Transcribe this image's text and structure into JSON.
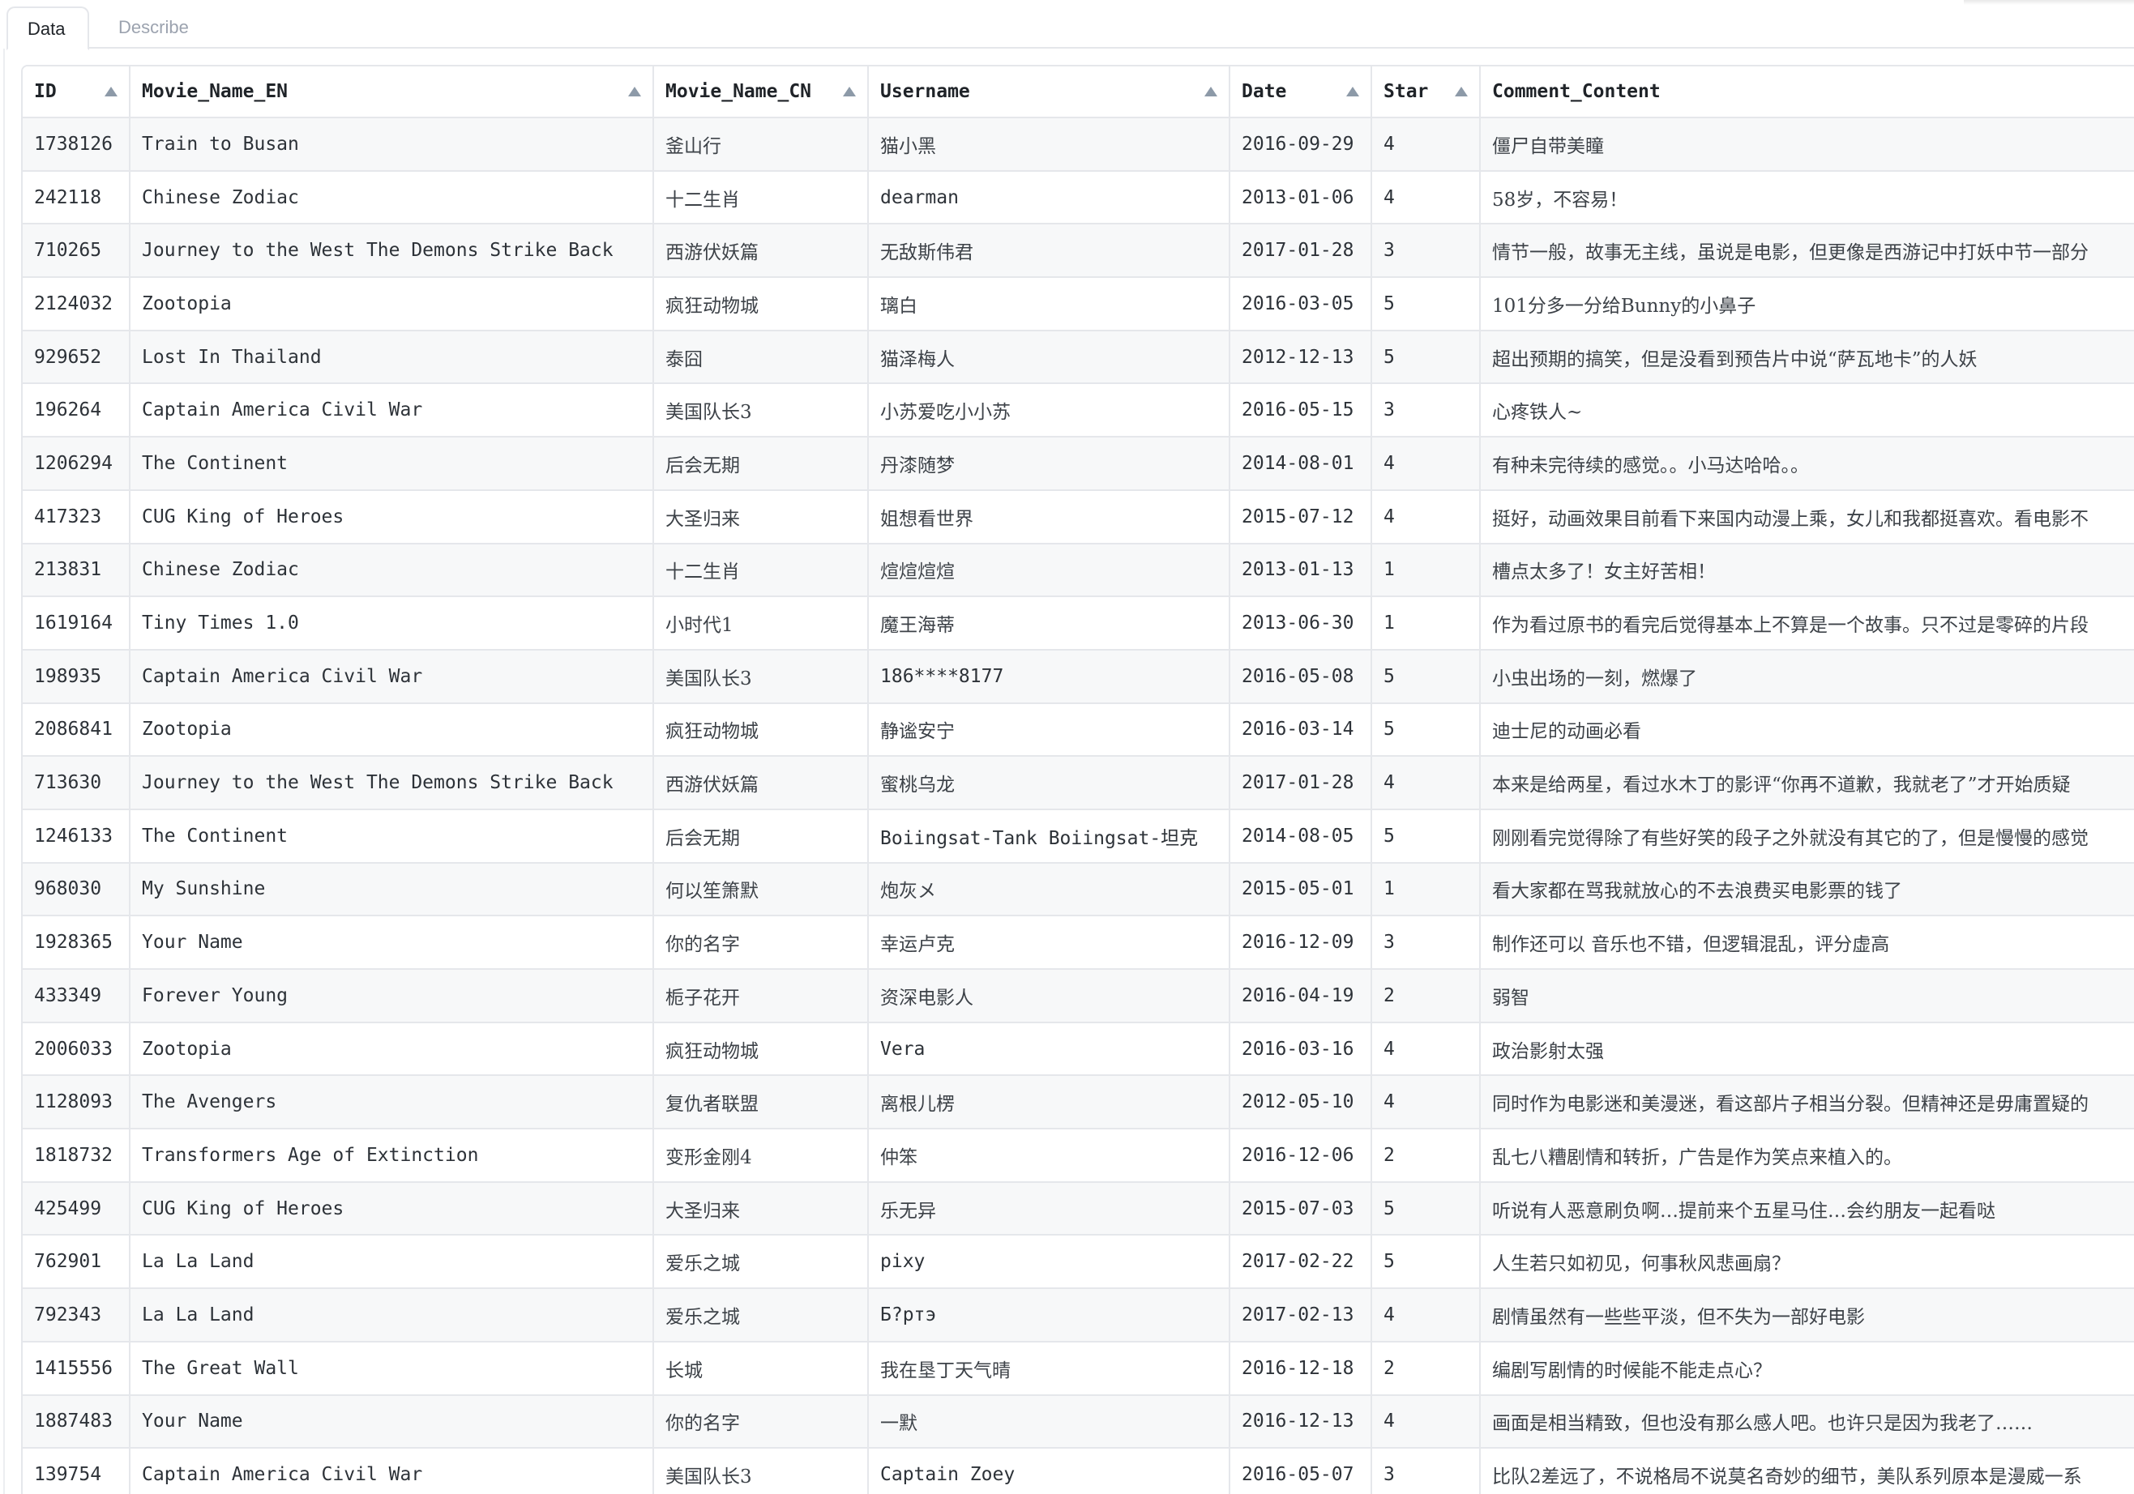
{
  "tabs": [
    {
      "label": "Data",
      "active": true
    },
    {
      "label": "Describe",
      "active": false
    }
  ],
  "table": {
    "columns": [
      "ID",
      "Movie_Name_EN",
      "Movie_Name_CN",
      "Username",
      "Date",
      "Star",
      "Comment_Content"
    ],
    "sortable": [
      true,
      true,
      true,
      true,
      true,
      true,
      false
    ],
    "rows": [
      [
        "1738126",
        "Train to Busan",
        "釜山行",
        "猫小黑",
        "2016-09-29",
        "4",
        "僵尸自带美瞳"
      ],
      [
        "242118",
        "Chinese Zodiac",
        "十二生肖",
        "dearman",
        "2013-01-06",
        "4",
        "58岁，不容易！"
      ],
      [
        "710265",
        "Journey to the West The Demons Strike Back",
        "西游伏妖篇",
        "无敌斯伟君",
        "2017-01-28",
        "3",
        "情节一般，故事无主线，虽说是电影，但更像是西游记中打妖中节一部分"
      ],
      [
        "2124032",
        "Zootopia",
        "疯狂动物城",
        "璃白",
        "2016-03-05",
        "5",
        "101分多一分给Bunny的小鼻子"
      ],
      [
        "929652",
        "Lost In Thailand",
        "泰囧",
        "猫泽梅人",
        "2012-12-13",
        "5",
        "超出预期的搞笑，但是没看到预告片中说“萨瓦地卡”的人妖"
      ],
      [
        "196264",
        "Captain America Civil War",
        "美国队长3",
        "小苏爱吃小小苏",
        "2016-05-15",
        "3",
        "心疼铁人~"
      ],
      [
        "1206294",
        "The Continent",
        "后会无期",
        "丹漆随梦",
        "2014-08-01",
        "4",
        "有种未完待续的感觉。。小马达哈哈。。"
      ],
      [
        "417323",
        "CUG King of Heroes",
        "大圣归来",
        "姐想看世界",
        "2015-07-12",
        "4",
        "挺好，动画效果目前看下来国内动漫上乘，女儿和我都挺喜欢。看电影不"
      ],
      [
        "213831",
        "Chinese Zodiac",
        "十二生肖",
        "煊煊煊煊",
        "2013-01-13",
        "1",
        "槽点太多了！女主好苦相！"
      ],
      [
        "1619164",
        "Tiny Times 1.0",
        "小时代1",
        "魔王海蒂",
        "2013-06-30",
        "1",
        "作为看过原书的看完后觉得基本上不算是一个故事。只不过是零碎的片段"
      ],
      [
        "198935",
        "Captain America Civil War",
        "美国队长3",
        "186****8177",
        "2016-05-08",
        "5",
        "小虫出场的一刻，燃爆了"
      ],
      [
        "2086841",
        "Zootopia",
        "疯狂动物城",
        "静谧安宁",
        "2016-03-14",
        "5",
        "迪士尼的动画必看"
      ],
      [
        "713630",
        "Journey to the West The Demons Strike Back",
        "西游伏妖篇",
        "蜜桃乌龙",
        "2017-01-28",
        "4",
        "本来是给两星，看过水木丁的影评“你再不道歉，我就老了”才开始质疑"
      ],
      [
        "1246133",
        "The Continent",
        "后会无期",
        "Boiingsat-Tank Boiingsat-坦克",
        "2014-08-05",
        "5",
        "刚刚看完觉得除了有些好笑的段子之外就没有其它的了，但是慢慢的感觉"
      ],
      [
        "968030",
        "My Sunshine",
        "何以笙箫默",
        "炮灰メ",
        "2015-05-01",
        "1",
        "看大家都在骂我就放心的不去浪费买电影票的钱了"
      ],
      [
        "1928365",
        "Your Name",
        "你的名字",
        "幸运卢克",
        "2016-12-09",
        "3",
        "制作还可以 音乐也不错，但逻辑混乱，评分虚高"
      ],
      [
        "433349",
        "Forever Young",
        "栀子花开",
        "资深电影人",
        "2016-04-19",
        "2",
        "弱智"
      ],
      [
        "2006033",
        "Zootopia",
        "疯狂动物城",
        "Vera",
        "2016-03-16",
        "4",
        "政治影射太强"
      ],
      [
        "1128093",
        "The Avengers",
        "复仇者联盟",
        "离根儿楞",
        "2012-05-10",
        "4",
        "同时作为电影迷和美漫迷，看这部片子相当分裂。但精神还是毋庸置疑的"
      ],
      [
        "1818732",
        "Transformers Age of Extinction",
        "变形金刚4",
        "仲笨",
        "2016-12-06",
        "2",
        "乱七八糟剧情和转折，广告是作为笑点来植入的。"
      ],
      [
        "425499",
        "CUG King of Heroes",
        "大圣归来",
        "乐无异",
        "2015-07-03",
        "5",
        "听说有人恶意刷负啊…提前来个五星马住…会约朋友一起看哒"
      ],
      [
        "762901",
        "La La Land",
        "爱乐之城",
        "pixy",
        "2017-02-22",
        "5",
        "人生若只如初见，何事秋风悲画扇？"
      ],
      [
        "792343",
        "La La Land",
        "爱乐之城",
        "Б?ртэ",
        "2017-02-13",
        "4",
        "剧情虽然有一些些平淡，但不失为一部好电影"
      ],
      [
        "1415556",
        "The Great Wall",
        "长城",
        "我在垦丁天气晴",
        "2016-12-18",
        "2",
        "编剧写剧情的时候能不能走点心？"
      ],
      [
        "1887483",
        "Your Name",
        "你的名字",
        "一默",
        "2016-12-13",
        "4",
        "画面是相当精致，但也没有那么感人吧。也许只是因为我老了……"
      ],
      [
        "139754",
        "Captain America Civil War",
        "美国队长3",
        "Captain Zoey",
        "2016-05-07",
        "3",
        "比队2差远了，不说格局不说莫名奇妙的细节，美队系列原本是漫威一系"
      ]
    ]
  }
}
